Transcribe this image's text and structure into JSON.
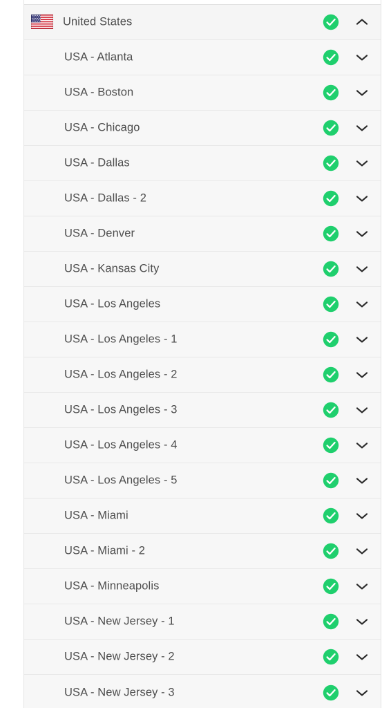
{
  "panel": {
    "name": "server-location-list",
    "background_color": "#f7f7f7",
    "border_color": "#e4e4e4",
    "row_separator_color": "#e8e8e8",
    "text_color": "#4d4d4d",
    "status_color": "#1fcf6d"
  },
  "icons": {
    "country_flag": "flag-united-states-icon",
    "status": "check-circle-icon",
    "expand": "chevron-down-icon",
    "collapse": "chevron-up-icon"
  },
  "rows": [
    {
      "label": "United States",
      "type": "country",
      "flag": "united-states-flag",
      "status": "check-circle-icon",
      "chevron": "chevron-up-icon",
      "expanded": true
    },
    {
      "label": "USA - Atlanta",
      "type": "server",
      "status": "check-circle-icon",
      "chevron": "chevron-down-icon",
      "expanded": false
    },
    {
      "label": "USA - Boston",
      "type": "server",
      "status": "check-circle-icon",
      "chevron": "chevron-down-icon",
      "expanded": false
    },
    {
      "label": "USA - Chicago",
      "type": "server",
      "status": "check-circle-icon",
      "chevron": "chevron-down-icon",
      "expanded": false
    },
    {
      "label": "USA - Dallas",
      "type": "server",
      "status": "check-circle-icon",
      "chevron": "chevron-down-icon",
      "expanded": false
    },
    {
      "label": "USA - Dallas - 2",
      "type": "server",
      "status": "check-circle-icon",
      "chevron": "chevron-down-icon",
      "expanded": false
    },
    {
      "label": "USA - Denver",
      "type": "server",
      "status": "check-circle-icon",
      "chevron": "chevron-down-icon",
      "expanded": false
    },
    {
      "label": "USA - Kansas City",
      "type": "server",
      "status": "check-circle-icon",
      "chevron": "chevron-down-icon",
      "expanded": false
    },
    {
      "label": "USA - Los Angeles",
      "type": "server",
      "status": "check-circle-icon",
      "chevron": "chevron-down-icon",
      "expanded": false
    },
    {
      "label": "USA - Los Angeles - 1",
      "type": "server",
      "status": "check-circle-icon",
      "chevron": "chevron-down-icon",
      "expanded": false
    },
    {
      "label": "USA - Los Angeles - 2",
      "type": "server",
      "status": "check-circle-icon",
      "chevron": "chevron-down-icon",
      "expanded": false
    },
    {
      "label": "USA - Los Angeles - 3",
      "type": "server",
      "status": "check-circle-icon",
      "chevron": "chevron-down-icon",
      "expanded": false
    },
    {
      "label": "USA - Los Angeles - 4",
      "type": "server",
      "status": "check-circle-icon",
      "chevron": "chevron-down-icon",
      "expanded": false
    },
    {
      "label": "USA - Los Angeles - 5",
      "type": "server",
      "status": "check-circle-icon",
      "chevron": "chevron-down-icon",
      "expanded": false
    },
    {
      "label": "USA - Miami",
      "type": "server",
      "status": "check-circle-icon",
      "chevron": "chevron-down-icon",
      "expanded": false
    },
    {
      "label": "USA - Miami - 2",
      "type": "server",
      "status": "check-circle-icon",
      "chevron": "chevron-down-icon",
      "expanded": false
    },
    {
      "label": "USA - Minneapolis",
      "type": "server",
      "status": "check-circle-icon",
      "chevron": "chevron-down-icon",
      "expanded": false
    },
    {
      "label": "USA - New Jersey - 1",
      "type": "server",
      "status": "check-circle-icon",
      "chevron": "chevron-down-icon",
      "expanded": false
    },
    {
      "label": "USA - New Jersey - 2",
      "type": "server",
      "status": "check-circle-icon",
      "chevron": "chevron-down-icon",
      "expanded": false
    },
    {
      "label": "USA - New Jersey - 3",
      "type": "server",
      "status": "check-circle-icon",
      "chevron": "chevron-down-icon",
      "expanded": false
    }
  ]
}
